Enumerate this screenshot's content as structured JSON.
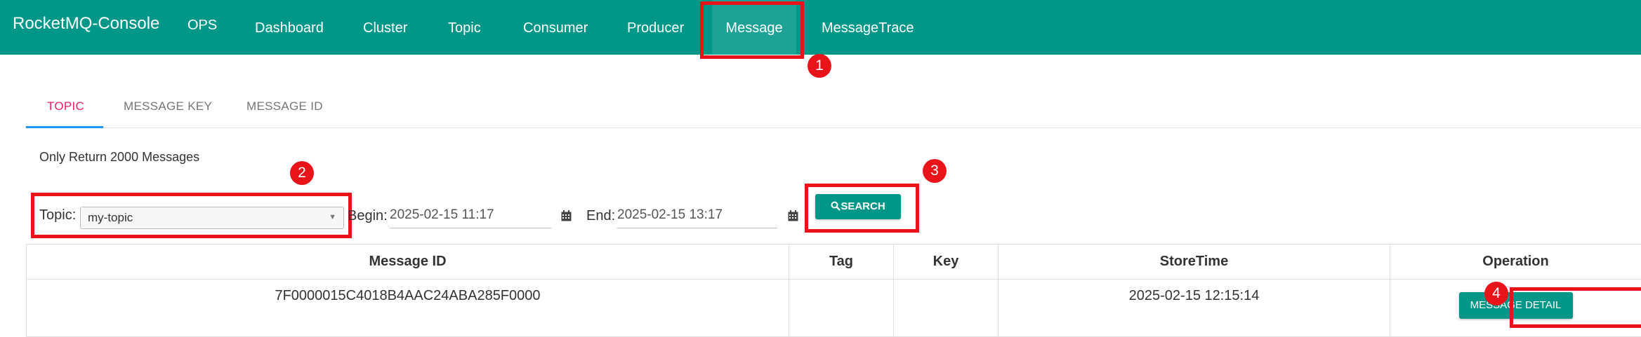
{
  "navbar": {
    "brand": "RocketMQ-Console",
    "items": [
      "OPS",
      "Dashboard",
      "Cluster",
      "Topic",
      "Consumer",
      "Producer",
      "Message",
      "MessageTrace"
    ],
    "active": "Message"
  },
  "tabs": [
    "TOPIC",
    "MESSAGE KEY",
    "MESSAGE ID"
  ],
  "active_tab": "TOPIC",
  "note": "Only Return 2000 Messages",
  "filters": {
    "topic_label": "Topic:",
    "topic_value": "my-topic",
    "begin_label": "Begin:",
    "begin_value": "2025-02-15 11:17",
    "end_label": "End:",
    "end_value": "2025-02-15 13:17",
    "search_label": "SEARCH"
  },
  "table": {
    "headers": [
      "Message ID",
      "Tag",
      "Key",
      "StoreTime",
      "Operation"
    ],
    "rows": [
      {
        "message_id": "7F0000015C4018B4AAC24ABA285F0000",
        "tag": "",
        "key": "",
        "store_time": "2025-02-15 12:15:14",
        "operation": "MESSAGE DETAIL"
      }
    ]
  },
  "annotations": [
    "1",
    "2",
    "3",
    "4"
  ],
  "colors": {
    "primary": "#009688",
    "annotation": "#e8141a",
    "tab_active": "#e91e63",
    "tab_indicator": "#2196f3"
  }
}
